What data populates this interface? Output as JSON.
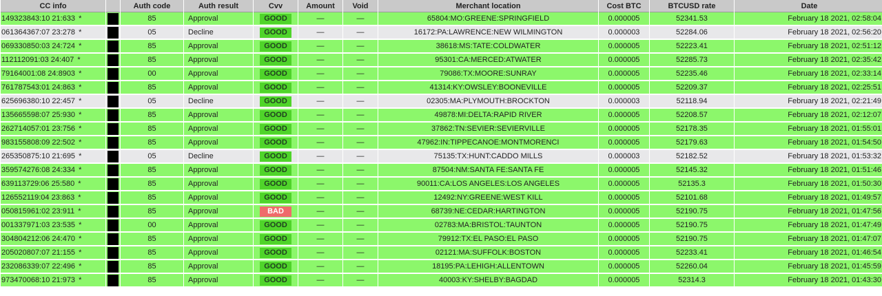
{
  "table": {
    "headers": [
      "CC info",
      "",
      "Auth code",
      "Auth result",
      "Cvv",
      "Amount",
      "Void",
      "Merchant location",
      "Cost BTC",
      "BTCUSD rate",
      "Date"
    ],
    "rows": [
      {
        "cc": "149323843:10 21:633",
        "mark": "*",
        "code": "85",
        "result": "Approval",
        "cvv": "GOOD",
        "amount": "—",
        "void": "—",
        "location": "65804:MO:GREENE:SPRINGFIELD",
        "cost": "0.000005",
        "rate": "52341.53",
        "date": "February 18 2021, 02:58:04"
      },
      {
        "cc": "061364367:07 23:278",
        "mark": "*",
        "code": "05",
        "result": "Decline",
        "cvv": "GOOD",
        "amount": "—",
        "void": "—",
        "location": "16172:PA:LAWRENCE:NEW WILMINGTON",
        "cost": "0.000003",
        "rate": "52284.06",
        "date": "February 18 2021, 02:56:20"
      },
      {
        "cc": "069330850:03 24:724",
        "mark": "*",
        "code": "85",
        "result": "Approval",
        "cvv": "GOOD",
        "amount": "—",
        "void": "—",
        "location": "38618:MS:TATE:COLDWATER",
        "cost": "0.000005",
        "rate": "52223.41",
        "date": "February 18 2021, 02:51:12"
      },
      {
        "cc": "112112091:03 24:407",
        "mark": "*",
        "code": "85",
        "result": "Approval",
        "cvv": "GOOD",
        "amount": "—",
        "void": "—",
        "location": "95301:CA:MERCED:ATWATER",
        "cost": "0.000005",
        "rate": "52285.73",
        "date": "February 18 2021, 02:35:42"
      },
      {
        "cc": "79164001:08 24:8903",
        "mark": "*",
        "code": "00",
        "result": "Approval",
        "cvv": "GOOD",
        "amount": "—",
        "void": "—",
        "location": "79086:TX:MOORE:SUNRAY",
        "cost": "0.000005",
        "rate": "52235.46",
        "date": "February 18 2021, 02:33:14"
      },
      {
        "cc": "761787543:01 24:863",
        "mark": "*",
        "code": "85",
        "result": "Approval",
        "cvv": "GOOD",
        "amount": "—",
        "void": "—",
        "location": "41314:KY:OWSLEY:BOONEVILLE",
        "cost": "0.000005",
        "rate": "52209.37",
        "date": "February 18 2021, 02:25:51"
      },
      {
        "cc": "625696380:10 22:457",
        "mark": "*",
        "code": "05",
        "result": "Decline",
        "cvv": "GOOD",
        "amount": "—",
        "void": "—",
        "location": "02305:MA:PLYMOUTH:BROCKTON",
        "cost": "0.000003",
        "rate": "52118.94",
        "date": "February 18 2021, 02:21:49"
      },
      {
        "cc": "135665598:07 25:930",
        "mark": "*",
        "code": "85",
        "result": "Approval",
        "cvv": "GOOD",
        "amount": "—",
        "void": "—",
        "location": "49878:MI:DELTA:RAPID RIVER",
        "cost": "0.000005",
        "rate": "52208.57",
        "date": "February 18 2021, 02:12:07"
      },
      {
        "cc": "262714057:01 23:756",
        "mark": "*",
        "code": "85",
        "result": "Approval",
        "cvv": "GOOD",
        "amount": "—",
        "void": "—",
        "location": "37862:TN:SEVIER:SEVIERVILLE",
        "cost": "0.000005",
        "rate": "52178.35",
        "date": "February 18 2021, 01:55:01"
      },
      {
        "cc": "983155808:09 22:502",
        "mark": "*",
        "code": "85",
        "result": "Approval",
        "cvv": "GOOD",
        "amount": "—",
        "void": "—",
        "location": "47962:IN:TIPPECANOE:MONTMORENCI",
        "cost": "0.000005",
        "rate": "52179.63",
        "date": "February 18 2021, 01:54:50"
      },
      {
        "cc": "265350875:10 21:695",
        "mark": "*",
        "code": "05",
        "result": "Decline",
        "cvv": "GOOD",
        "amount": "—",
        "void": "—",
        "location": "75135:TX:HUNT:CADDO MILLS",
        "cost": "0.000003",
        "rate": "52182.52",
        "date": "February 18 2021, 01:53:32"
      },
      {
        "cc": "359574276:08 24:334",
        "mark": "*",
        "code": "85",
        "result": "Approval",
        "cvv": "GOOD",
        "amount": "—",
        "void": "—",
        "location": "87504:NM:SANTA FE:SANTA FE",
        "cost": "0.000005",
        "rate": "52145.32",
        "date": "February 18 2021, 01:51:46"
      },
      {
        "cc": "639113729:06 25:580",
        "mark": "*",
        "code": "85",
        "result": "Approval",
        "cvv": "GOOD",
        "amount": "—",
        "void": "—",
        "location": "90011:CA:LOS ANGELES:LOS ANGELES",
        "cost": "0.000005",
        "rate": "52135.3",
        "date": "February 18 2021, 01:50:30"
      },
      {
        "cc": "126552119:04 23:863",
        "mark": "*",
        "code": "85",
        "result": "Approval",
        "cvv": "GOOD",
        "amount": "—",
        "void": "—",
        "location": "12492:NY:GREENE:WEST KILL",
        "cost": "0.000005",
        "rate": "52101.68",
        "date": "February 18 2021, 01:49:57"
      },
      {
        "cc": "050815961:02 23:911",
        "mark": "*",
        "code": "85",
        "result": "Approval",
        "cvv": "BAD",
        "amount": "—",
        "void": "—",
        "location": "68739:NE:CEDAR:HARTINGTON",
        "cost": "0.000005",
        "rate": "52190.75",
        "date": "February 18 2021, 01:47:56"
      },
      {
        "cc": "001337971:03 23:535",
        "mark": "*",
        "code": "00",
        "result": "Approval",
        "cvv": "GOOD",
        "amount": "—",
        "void": "—",
        "location": "02783:MA:BRISTOL:TAUNTON",
        "cost": "0.000005",
        "rate": "52190.75",
        "date": "February 18 2021, 01:47:49"
      },
      {
        "cc": "304804212:06 24:470",
        "mark": "*",
        "code": "85",
        "result": "Approval",
        "cvv": "GOOD",
        "amount": "—",
        "void": "—",
        "location": "79912:TX:EL PASO:EL PASO",
        "cost": "0.000005",
        "rate": "52190.75",
        "date": "February 18 2021, 01:47:07"
      },
      {
        "cc": "205020807:07 21:155",
        "mark": "*",
        "code": "85",
        "result": "Approval",
        "cvv": "GOOD",
        "amount": "—",
        "void": "—",
        "location": "02121:MA:SUFFOLK:BOSTON",
        "cost": "0.000005",
        "rate": "52233.41",
        "date": "February 18 2021, 01:46:54"
      },
      {
        "cc": "232086339:07 22:496",
        "mark": "*",
        "code": "85",
        "result": "Approval",
        "cvv": "GOOD",
        "amount": "—",
        "void": "—",
        "location": "18195:PA:LEHIGH:ALLENTOWN",
        "cost": "0.000005",
        "rate": "52260.04",
        "date": "February 18 2021, 01:45:59"
      },
      {
        "cc": "973470068:10 21:973",
        "mark": "*",
        "code": "85",
        "result": "Approval",
        "cvv": "GOOD",
        "amount": "—",
        "void": "—",
        "location": "40003:KY:SHELBY:BAGDAD",
        "cost": "0.000005",
        "rate": "52314.3",
        "date": "February 18 2021, 01:43:30"
      }
    ]
  },
  "colors": {
    "approval_row": "#8cf76b",
    "decline_row": "#e8e8ea",
    "cvv_good": "#4fd42a",
    "cvv_bad": "#ef6b6b",
    "header_bg": "#c9c9c9"
  }
}
